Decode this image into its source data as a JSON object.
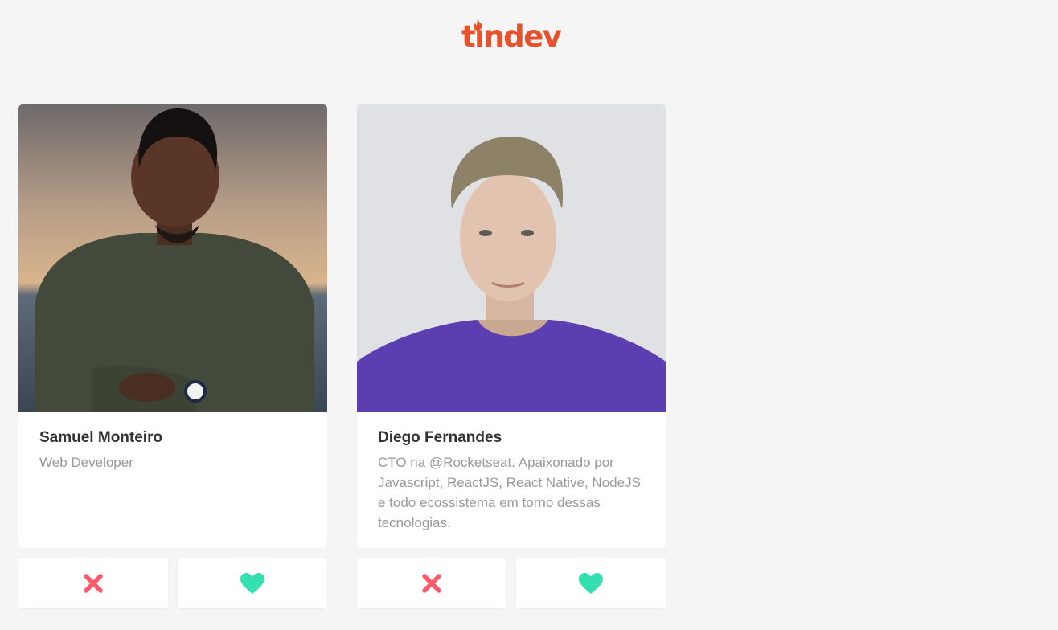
{
  "header": {
    "logo_text": "tindev"
  },
  "colors": {
    "brand": "#e8522a",
    "dislike": "#ff5a6a",
    "like": "#34e0b0"
  },
  "devs": [
    {
      "name": "Samuel Monteiro",
      "bio": "Web Developer",
      "dislike_icon": "x-icon",
      "like_icon": "heart-icon"
    },
    {
      "name": "Diego Fernandes",
      "bio": "CTO na @Rocketseat. Apaixonado por Javascript, ReactJS, React Native, NodeJS e todo ecossistema em torno dessas tecnologias.",
      "dislike_icon": "x-icon",
      "like_icon": "heart-icon"
    }
  ]
}
